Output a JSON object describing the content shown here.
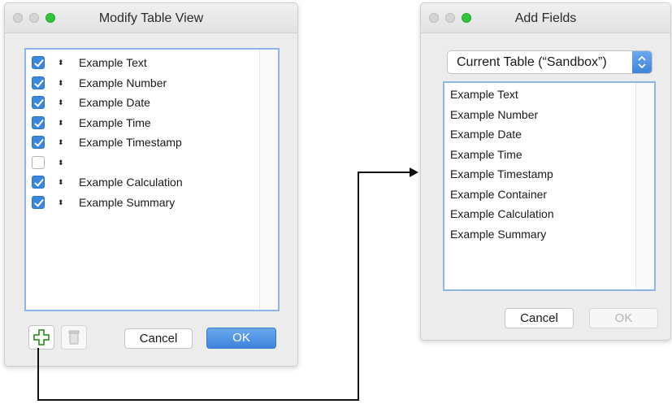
{
  "modify": {
    "title": "Modify Table View",
    "rows": [
      {
        "label": "Example Text",
        "checked": true
      },
      {
        "label": "Example Number",
        "checked": true
      },
      {
        "label": "Example Date",
        "checked": true
      },
      {
        "label": "Example Time",
        "checked": true
      },
      {
        "label": "Example Timestamp",
        "checked": true
      },
      {
        "label": "",
        "checked": false
      },
      {
        "label": "Example Calculation",
        "checked": true
      },
      {
        "label": "Example Summary",
        "checked": true
      }
    ],
    "reorder_glyph": "⬍",
    "cancel_label": "Cancel",
    "ok_label": "OK",
    "add_icon": "plus-icon",
    "delete_icon": "trash-icon"
  },
  "add_fields": {
    "title": "Add Fields",
    "table_select": "Current Table (“Sandbox”)",
    "fields": [
      "Example Text",
      "Example Number",
      "Example Date",
      "Example Time",
      "Example Timestamp",
      "Example Container",
      "Example Calculation",
      "Example Summary"
    ],
    "cancel_label": "Cancel",
    "ok_label": "OK"
  },
  "colors": {
    "accent": "#3a87e0",
    "arrow": "#111111",
    "traffic_green": "#2fc43f"
  }
}
